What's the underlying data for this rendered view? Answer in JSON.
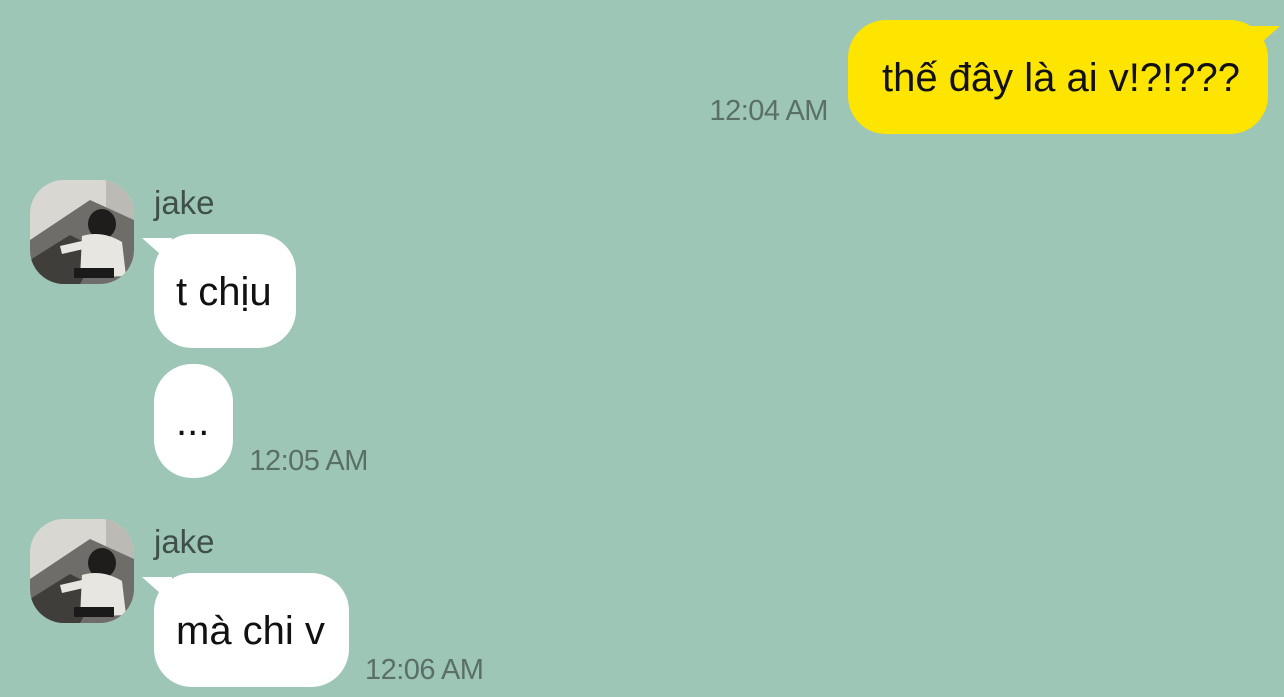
{
  "messages": [
    {
      "direction": "out",
      "text": "thế đây là ai v!?!???",
      "time": "12:04 AM"
    },
    {
      "direction": "in",
      "sender": "jake",
      "text": "t chịu"
    },
    {
      "direction": "in",
      "text": "...",
      "time": "12:05 AM"
    },
    {
      "direction": "in",
      "sender": "jake",
      "text": "mà chi v",
      "time": "12:06 AM"
    }
  ],
  "colors": {
    "background": "#9dc6b6",
    "outgoing_bubble": "#fee500",
    "incoming_bubble": "#ffffff"
  },
  "icons": {
    "avatar": "profile-photo"
  }
}
